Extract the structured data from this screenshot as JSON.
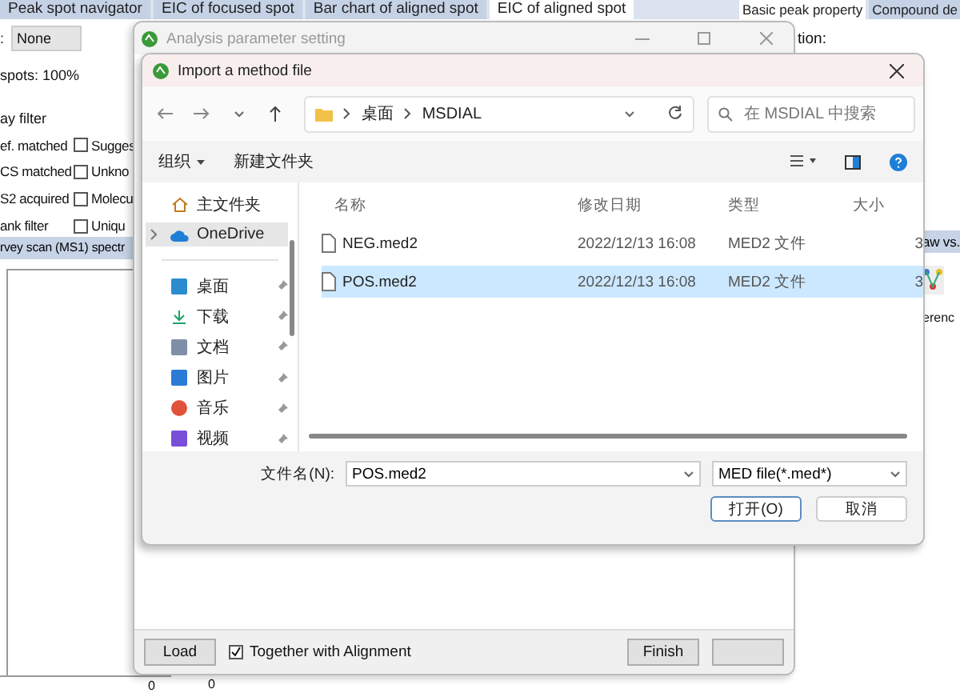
{
  "background_app": {
    "tab_groups": [
      {
        "tabs": [
          {
            "label": "Peak spot navigator",
            "selected": false
          },
          {
            "label": "EIC of focused spot",
            "selected": false
          },
          {
            "label": "Bar chart of aligned spot",
            "selected": false
          },
          {
            "label": "EIC of aligned spot",
            "selected": true
          }
        ]
      },
      {
        "tabs": [
          {
            "label": "Basic peak property",
            "selected": true
          },
          {
            "label": "Compound de",
            "selected": false
          }
        ]
      }
    ],
    "left_panel": {
      "dropdown_label": ":",
      "dropdown_value": "None",
      "spots_text": "spots: 100%",
      "filter_title": "ay filter",
      "filters": [
        {
          "label": "ef. matched",
          "right_label": "Sugges",
          "right_checked": false
        },
        {
          "label": "CS matched",
          "right_label": "Unkno",
          "right_checked": false
        },
        {
          "label": "S2 acquired",
          "right_label": "Molecu",
          "right_checked": false
        },
        {
          "label": "ank filter",
          "right_label": "Uniqu",
          "right_checked": false
        }
      ]
    },
    "spectrum_header": "rvey scan (MS1) spectr",
    "axis_labels": [
      "0",
      "0"
    ],
    "right_panel": {
      "label": "tion:",
      "header": "aw vs.",
      "text": "erenc"
    }
  },
  "parameter_window": {
    "title": "Analysis parameter setting",
    "load_button": "Load",
    "together": {
      "label": "Together with Alignment",
      "checked": true
    },
    "finish_button": "Finish"
  },
  "file_dialog": {
    "title": "Import a method file",
    "path": [
      "桌面",
      "MSDIAL"
    ],
    "search": {
      "placeholder": "在 MSDIAL 中搜索"
    },
    "toolbar": {
      "organize": "组织",
      "new_folder": "新建文件夹"
    },
    "sidebar": [
      {
        "label": "主文件夹",
        "selected": false,
        "pinned": false,
        "expandable": false
      },
      {
        "label": "OneDrive",
        "selected": true,
        "pinned": false,
        "expandable": true
      },
      {
        "label": "桌面",
        "selected": false,
        "pinned": true,
        "expandable": false
      },
      {
        "label": "下载",
        "selected": false,
        "pinned": true,
        "expandable": false
      },
      {
        "label": "文档",
        "selected": false,
        "pinned": true,
        "expandable": false
      },
      {
        "label": "图片",
        "selected": false,
        "pinned": true,
        "expandable": false
      },
      {
        "label": "音乐",
        "selected": false,
        "pinned": true,
        "expandable": false
      },
      {
        "label": "视频",
        "selected": false,
        "pinned": true,
        "expandable": false
      }
    ],
    "columns": [
      "名称",
      "修改日期",
      "类型",
      "大小"
    ],
    "rows": [
      {
        "name": "NEG.med2",
        "date": "2022/12/13 16:08",
        "type": "MED2 文件",
        "size": "3",
        "selected": false
      },
      {
        "name": "POS.med2",
        "date": "2022/12/13 16:08",
        "type": "MED2 文件",
        "size": "3",
        "selected": true
      }
    ],
    "file_name_label": "文件名(N):",
    "file_name": "POS.med2",
    "filter": "MED file(*.med*)",
    "open_button": "打开(O)",
    "cancel_button": "取消"
  }
}
